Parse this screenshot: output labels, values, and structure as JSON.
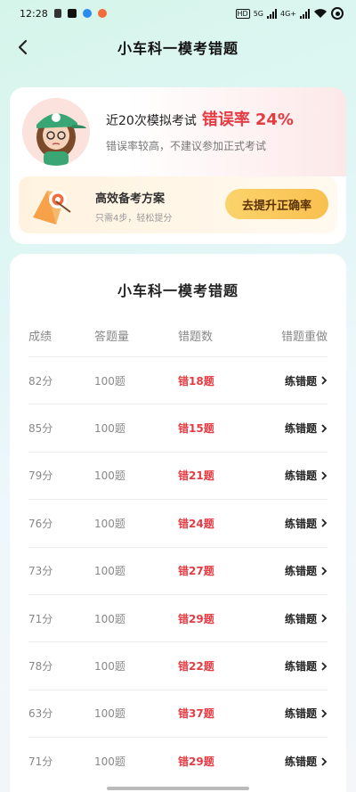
{
  "status": {
    "time": "12:28",
    "hd_badge": "HD",
    "net_5g": "5G",
    "net_4g": "4G+"
  },
  "nav": {
    "title": "小车科一模考错题"
  },
  "summary": {
    "prefix": "近20次模拟考试",
    "label": "错误率",
    "value": "24%",
    "tip": "错误率较高，不建议参加正式考试"
  },
  "plan": {
    "title": "高效备考方案",
    "subtitle": "只需4步，轻松提分",
    "button": "去提升正确率"
  },
  "list": {
    "title": "小车科一模考错题",
    "headers": [
      "成绩",
      "答题量",
      "错题数",
      "错题重做"
    ],
    "rows": [
      {
        "score": "82分",
        "total": "100题",
        "wrong": "错18题",
        "action": "练错题"
      },
      {
        "score": "85分",
        "total": "100题",
        "wrong": "错15题",
        "action": "练错题"
      },
      {
        "score": "79分",
        "total": "100题",
        "wrong": "错21题",
        "action": "练错题"
      },
      {
        "score": "76分",
        "total": "100题",
        "wrong": "错24题",
        "action": "练错题"
      },
      {
        "score": "73分",
        "total": "100题",
        "wrong": "错27题",
        "action": "练错题"
      },
      {
        "score": "71分",
        "total": "100题",
        "wrong": "错29题",
        "action": "练错题"
      },
      {
        "score": "78分",
        "total": "100题",
        "wrong": "错22题",
        "action": "练错题"
      },
      {
        "score": "63分",
        "total": "100题",
        "wrong": "错37题",
        "action": "练错题"
      },
      {
        "score": "71分",
        "total": "100题",
        "wrong": "错29题",
        "action": "练错题"
      }
    ]
  },
  "colors": {
    "accent_red": "#e53c44",
    "button_yellow": "#f9c04f"
  }
}
